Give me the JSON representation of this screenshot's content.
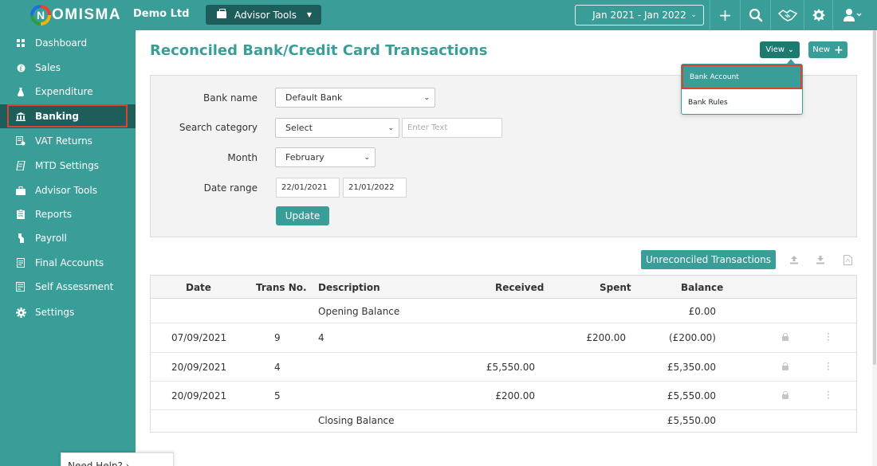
{
  "app": {
    "brand_initial": "N",
    "brand_rest": "OMISMA",
    "company": "Demo Ltd"
  },
  "header": {
    "advisor_tools_label": "Advisor Tools",
    "date_range_label": "Jan 2021 - Jan 2022",
    "icons": [
      "plus-icon",
      "search-icon",
      "handshake-icon",
      "crest-icon",
      "user-icon"
    ]
  },
  "sidebar": {
    "items": [
      {
        "label": "Dashboard",
        "icon": "dashboard-icon"
      },
      {
        "label": "Sales",
        "icon": "sales-icon"
      },
      {
        "label": "Expenditure",
        "icon": "expenditure-icon"
      },
      {
        "label": "Banking",
        "icon": "bank-icon",
        "active": true
      },
      {
        "label": "VAT Returns",
        "icon": "vat-icon"
      },
      {
        "label": "MTD Settings",
        "icon": "mtd-icon"
      },
      {
        "label": "Advisor Tools",
        "icon": "briefcase-icon"
      },
      {
        "label": "Reports",
        "icon": "reports-icon"
      },
      {
        "label": "Payroll",
        "icon": "payroll-icon"
      },
      {
        "label": "Final Accounts",
        "icon": "final-accounts-icon"
      },
      {
        "label": "Self Assessment",
        "icon": "self-assessment-icon"
      },
      {
        "label": "Settings",
        "icon": "gear-icon"
      }
    ]
  },
  "page": {
    "title": "Reconciled Bank/Credit Card Transactions",
    "view_label": "View",
    "new_label": "New",
    "view_menu": [
      "Bank Account",
      "Bank Rules"
    ]
  },
  "filters": {
    "bank_name_label": "Bank name",
    "bank_name_value": "Default Bank",
    "search_category_label": "Search category",
    "search_category_value": "Select",
    "search_text_placeholder": "Enter Text",
    "month_label": "Month",
    "month_value": "February",
    "date_range_label": "Date range",
    "date_from": "22/01/2021",
    "date_to": "21/01/2022",
    "update_label": "Update"
  },
  "actions": {
    "unreconciled_label": "Unreconciled Transactions"
  },
  "table": {
    "headers": {
      "date": "Date",
      "trans_no": "Trans No.",
      "description": "Description",
      "received": "Received",
      "spent": "Spent",
      "balance": "Balance"
    },
    "opening": {
      "description": "Opening Balance",
      "balance": "£0.00"
    },
    "rows": [
      {
        "date": "07/09/2021",
        "trans_no": "9",
        "description": "4",
        "received": "",
        "spent": "£200.00",
        "balance": "(£200.00)"
      },
      {
        "date": "20/09/2021",
        "trans_no": "4",
        "description": "",
        "received": "£5,550.00",
        "spent": "",
        "balance": "£5,350.00"
      },
      {
        "date": "20/09/2021",
        "trans_no": "5",
        "description": "",
        "received": "£200.00",
        "spent": "",
        "balance": "£5,550.00"
      }
    ],
    "closing": {
      "description": "Closing Balance",
      "balance": "£5,550.00"
    }
  },
  "help": {
    "label": "Need Help? ›"
  },
  "colors": {
    "primary": "#3a9e98",
    "dark": "#1d5e5a",
    "highlight": "#d9442e"
  }
}
